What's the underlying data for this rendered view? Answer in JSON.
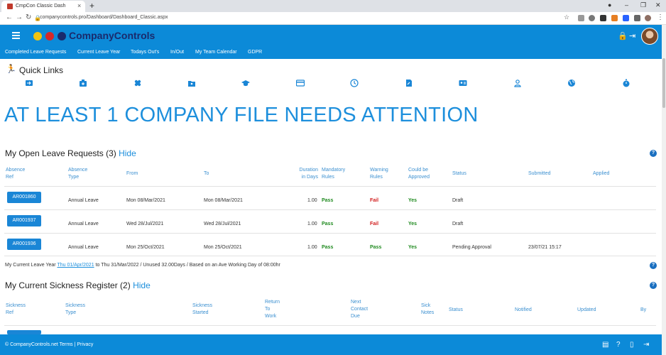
{
  "browser": {
    "tab_title": "CmpCon Classic Dash",
    "tab_close": "×",
    "new_tab": "+",
    "url": "companycontrols.pro/Dashboard/Dashboard_Classic.aspx"
  },
  "app": {
    "logo_text": "CompanyControls",
    "nav": [
      "Completed Leave Requests",
      "Current Leave Year",
      "Todays Out's",
      "In/Out",
      "My Team Calendar",
      "GDPR"
    ]
  },
  "quick_links": {
    "title": "Quick Links",
    "icons": [
      "sign-in-icon",
      "medical-bag-icon",
      "bandage-icon",
      "folder-user-icon",
      "graduation-cap-icon",
      "credit-card-icon",
      "clock-icon",
      "document-edit-icon",
      "id-card-icon",
      "user-icon",
      "globe-icon",
      "stopwatch-icon"
    ]
  },
  "alert_text": "AT LEAST 1 COMPANY FILE NEEDS ATTENTION",
  "leave": {
    "title": "My Open Leave Requests (3)",
    "hide_label": "Hide",
    "headers": {
      "ref": [
        "Absence",
        "Ref"
      ],
      "type": [
        "Absence",
        "Type"
      ],
      "from": "From",
      "to": "To",
      "duration": [
        "Duration",
        "in Days"
      ],
      "mandatory": [
        "Mandatory",
        "Rules"
      ],
      "warning": [
        "Warning",
        "Rules"
      ],
      "approved": [
        "Could be",
        "Approved"
      ],
      "status": "Status",
      "submitted": "Submitted",
      "applied": "Applied"
    },
    "rows": [
      {
        "ref": "AR001860",
        "type": "Annual Leave",
        "from": "Mon 08/Mar/2021",
        "to": "Mon 08/Mar/2021",
        "duration": "1.00",
        "mandatory": "Pass",
        "warning": "Fail",
        "approved": "Yes",
        "status": "Draft",
        "submitted": ""
      },
      {
        "ref": "AR001937",
        "type": "Annual Leave",
        "from": "Wed 28/Jul/2021",
        "to": "Wed 28/Jul/2021",
        "duration": "1.00",
        "mandatory": "Pass",
        "warning": "Fail",
        "approved": "Yes",
        "status": "Draft",
        "submitted": ""
      },
      {
        "ref": "AR001936",
        "type": "Annual Leave",
        "from": "Mon 25/Oct/2021",
        "to": "Mon 25/Oct/2021",
        "duration": "1.00",
        "mandatory": "Pass",
        "warning": "Pass",
        "approved": "Yes",
        "status": "Pending Approval",
        "submitted": "23/07/21 15:17"
      }
    ],
    "info_prefix": "My Current Leave Year",
    "info_link": "Thu 01/Apr/2021",
    "info_suffix": "to Thu 31/Mar/2022 / Unused 32.00Days / Based on an Ave Working Day of 08:00hr"
  },
  "sickness": {
    "title": "My Current Sickness Register (2)",
    "hide_label": "Hide",
    "headers": {
      "ref": [
        "Sickness",
        "Ref"
      ],
      "type": [
        "Sickness",
        "Type"
      ],
      "started": [
        "Sickness",
        "Started"
      ],
      "return": [
        "Return",
        "To",
        "Work"
      ],
      "next": [
        "Next",
        "Contact",
        "Due"
      ],
      "notes": [
        "Sick",
        "Notes"
      ],
      "status": "Status",
      "notified": "Notified",
      "updated": "Updated",
      "by": "By"
    }
  },
  "footer": {
    "text": "© CompanyControls.net Terms | Privacy"
  },
  "help_label": "?"
}
